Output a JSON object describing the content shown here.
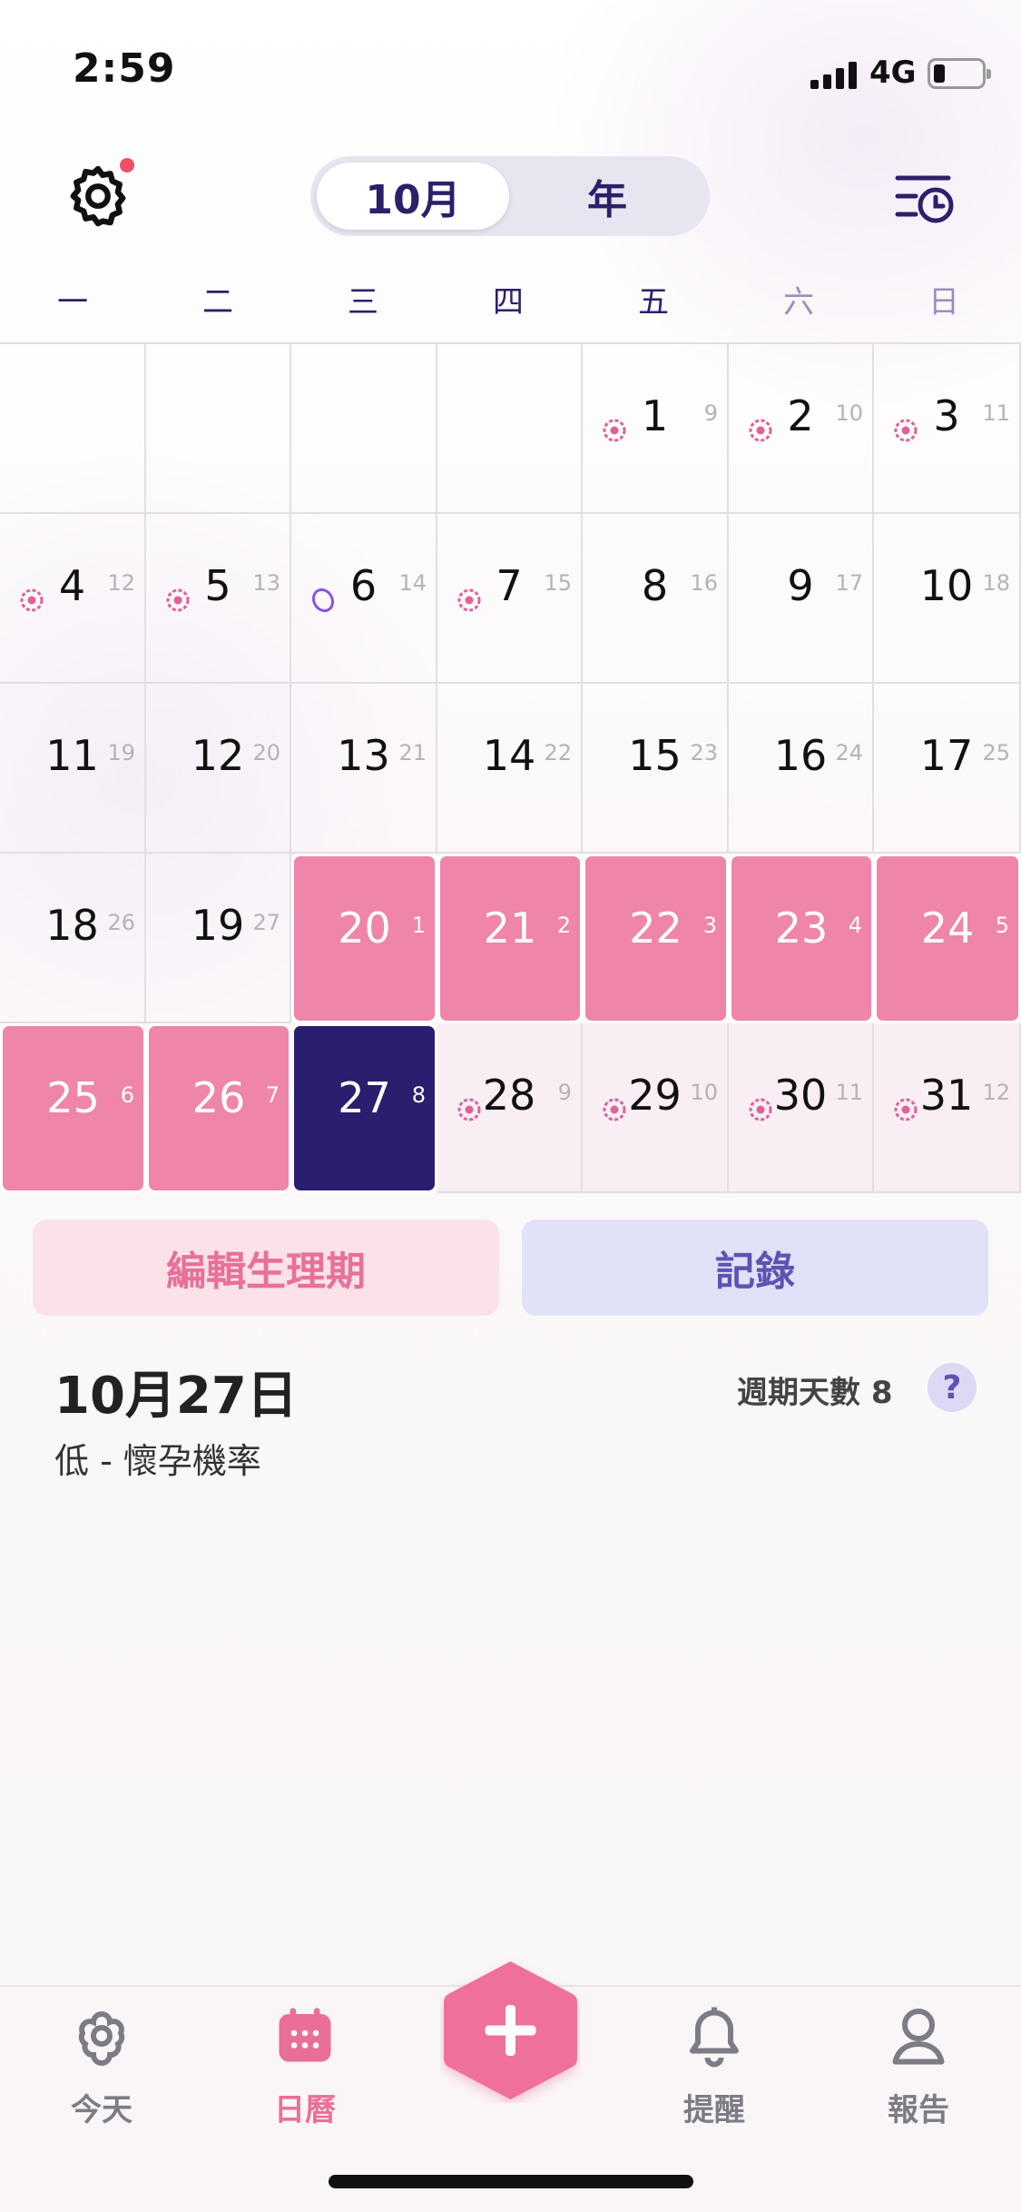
{
  "status_bar": {
    "time": "2:59",
    "network": "4G"
  },
  "header": {
    "segment": {
      "month_label": "10月",
      "year_label": "年"
    }
  },
  "weekdays": [
    "一",
    "二",
    "三",
    "四",
    "五",
    "六",
    "日"
  ],
  "calendar": {
    "days": [
      {
        "day": "1",
        "sub": "9",
        "mark": "ovulation"
      },
      {
        "day": "2",
        "sub": "10",
        "mark": "ovulation"
      },
      {
        "day": "3",
        "sub": "11",
        "mark": "ovulation"
      },
      {
        "day": "4",
        "sub": "12",
        "mark": "ovulation"
      },
      {
        "day": "5",
        "sub": "13",
        "mark": "ovulation"
      },
      {
        "day": "6",
        "sub": "14",
        "mark": "egg"
      },
      {
        "day": "7",
        "sub": "15",
        "mark": "ovulation"
      },
      {
        "day": "8",
        "sub": "16",
        "mark": ""
      },
      {
        "day": "9",
        "sub": "17",
        "mark": ""
      },
      {
        "day": "10",
        "sub": "18",
        "mark": ""
      },
      {
        "day": "11",
        "sub": "19",
        "mark": ""
      },
      {
        "day": "12",
        "sub": "20",
        "mark": ""
      },
      {
        "day": "13",
        "sub": "21",
        "mark": ""
      },
      {
        "day": "14",
        "sub": "22",
        "mark": ""
      },
      {
        "day": "15",
        "sub": "23",
        "mark": ""
      },
      {
        "day": "16",
        "sub": "24",
        "mark": ""
      },
      {
        "day": "17",
        "sub": "25",
        "mark": ""
      },
      {
        "day": "18",
        "sub": "26",
        "mark": ""
      },
      {
        "day": "19",
        "sub": "27",
        "mark": ""
      },
      {
        "day": "20",
        "sub": "1",
        "mark": "",
        "state": "period"
      },
      {
        "day": "21",
        "sub": "2",
        "mark": "",
        "state": "period"
      },
      {
        "day": "22",
        "sub": "3",
        "mark": "",
        "state": "period"
      },
      {
        "day": "23",
        "sub": "4",
        "mark": "",
        "state": "period"
      },
      {
        "day": "24",
        "sub": "5",
        "mark": "",
        "state": "period"
      },
      {
        "day": "25",
        "sub": "6",
        "mark": "",
        "state": "period"
      },
      {
        "day": "26",
        "sub": "7",
        "mark": "",
        "state": "period"
      },
      {
        "day": "27",
        "sub": "8",
        "mark": "",
        "state": "today"
      },
      {
        "day": "28",
        "sub": "9",
        "mark": "ovulation",
        "state": "soft"
      },
      {
        "day": "29",
        "sub": "10",
        "mark": "ovulation",
        "state": "soft"
      },
      {
        "day": "30",
        "sub": "11",
        "mark": "ovulation",
        "state": "soft"
      },
      {
        "day": "31",
        "sub": "12",
        "mark": "ovulation",
        "state": "soft"
      }
    ],
    "first_weekday_index": 4
  },
  "actions": {
    "edit_period": "編輯生理期",
    "log": "記錄"
  },
  "selected": {
    "date": "10月27日",
    "fertility": "低 - 懷孕機率",
    "cycle_day_label": "週期天數 8",
    "help": "?"
  },
  "tabbar": {
    "today": "今天",
    "calendar": "日曆",
    "reminders": "提醒",
    "report": "報告"
  },
  "colors": {
    "period": "#ef85a8",
    "today": "#2a1f6e",
    "accent": "#ea6f98",
    "primary_text": "#2d1f6a"
  }
}
